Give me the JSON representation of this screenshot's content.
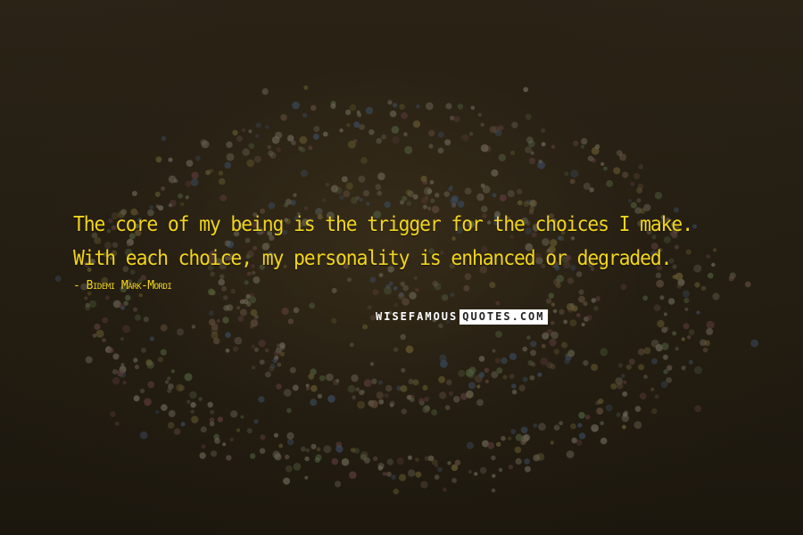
{
  "quote": {
    "text": "The core of my being is the trigger for the choices I make. With each choice, my personality is enhanced or degraded."
  },
  "author": {
    "text": "- Bidemi Mark-Mordi"
  },
  "brand": {
    "part1": "WISEFAMOUS",
    "part2": "QUOTES.COM"
  },
  "colors": {
    "quote_text": "#f2d51a",
    "background": "#231d12",
    "brand_light": "#ffffff",
    "brand_dark": "#222222"
  }
}
